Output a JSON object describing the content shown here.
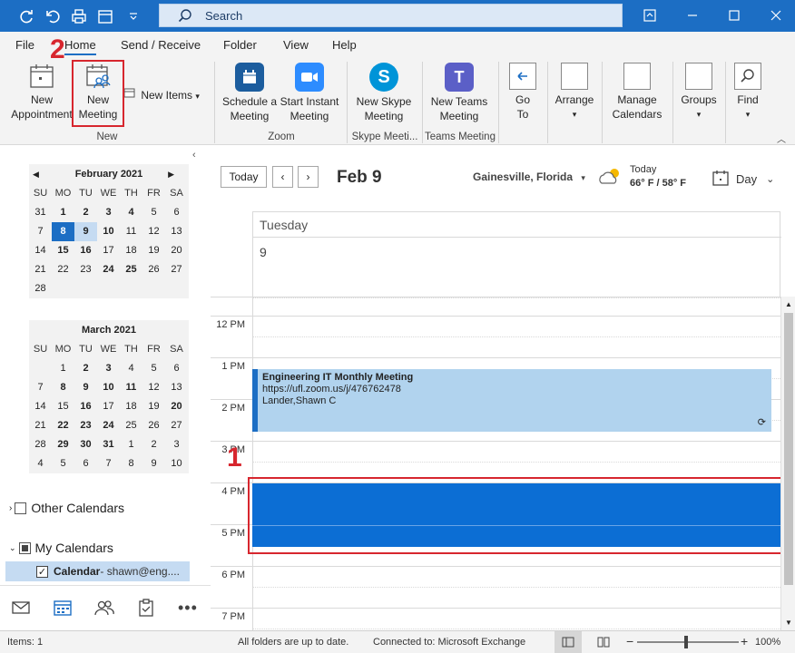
{
  "titlebar": {
    "search_placeholder": "Search"
  },
  "menu": [
    "File",
    "Home",
    "Send / Receive",
    "Folder",
    "View",
    "Help"
  ],
  "ribbon": {
    "new_appointment": [
      "New",
      "Appointment"
    ],
    "new_meeting": [
      "New",
      "Meeting"
    ],
    "new_items": "New Items",
    "group_new": "New",
    "schedule_meeting": [
      "Schedule a",
      "Meeting"
    ],
    "start_instant": [
      "Start Instant",
      "Meeting"
    ],
    "group_zoom": "Zoom",
    "new_skype": [
      "New Skype",
      "Meeting"
    ],
    "group_skype": "Skype Meeti...",
    "new_teams": [
      "New Teams",
      "Meeting"
    ],
    "group_teams": "Teams Meeting",
    "goto": [
      "Go",
      "To"
    ],
    "arrange": "Arrange",
    "manage": [
      "Manage",
      "Calendars"
    ],
    "groups": "Groups",
    "find": "Find"
  },
  "annotations": {
    "step1": "1",
    "step2": "2"
  },
  "minical": [
    {
      "title": "February 2021",
      "dow": [
        "SU",
        "MO",
        "TU",
        "WE",
        "TH",
        "FR",
        "SA"
      ],
      "weeks": [
        [
          "31",
          "1",
          "2",
          "3",
          "4",
          "5",
          "6"
        ],
        [
          "7",
          "8",
          "9",
          "10",
          "11",
          "12",
          "13"
        ],
        [
          "14",
          "15",
          "16",
          "17",
          "18",
          "19",
          "20"
        ],
        [
          "21",
          "22",
          "23",
          "24",
          "25",
          "26",
          "27"
        ],
        [
          "28",
          "",
          "",
          "",
          "",
          "",
          ""
        ]
      ]
    },
    {
      "title": "March 2021",
      "dow": [
        "SU",
        "MO",
        "TU",
        "WE",
        "TH",
        "FR",
        "SA"
      ],
      "weeks": [
        [
          "",
          "1",
          "2",
          "3",
          "4",
          "5",
          "6"
        ],
        [
          "7",
          "8",
          "9",
          "10",
          "11",
          "12",
          "13"
        ],
        [
          "14",
          "15",
          "16",
          "17",
          "18",
          "19",
          "20"
        ],
        [
          "21",
          "22",
          "23",
          "24",
          "25",
          "26",
          "27"
        ],
        [
          "28",
          "29",
          "30",
          "31",
          "1",
          "2",
          "3"
        ],
        [
          "4",
          "5",
          "6",
          "7",
          "8",
          "9",
          "10"
        ]
      ]
    }
  ],
  "folders": {
    "other": "Other Calendars",
    "my": "My Calendars",
    "calendar_name": "Calendar",
    "calendar_owner": " - shawn@eng...."
  },
  "calendar": {
    "today_btn": "Today",
    "date_title": "Feb 9",
    "location": "Gainesville, Florida",
    "weather_label": "Today",
    "weather_temp": "66° F / 58° F",
    "view": "Day",
    "day_name": "Tuesday",
    "day_num": "9",
    "hours": [
      "12 PM",
      "1 PM",
      "2 PM",
      "3 PM",
      "4 PM",
      "5 PM",
      "6 PM",
      "7 PM"
    ],
    "appointment": {
      "title": "Engineering IT Monthly Meeting",
      "url": "https://ufl.zoom.us/j/476762478",
      "organizer": "Lander,Shawn C"
    }
  },
  "status": {
    "items": "Items: 1",
    "sync": "All folders are up to date.",
    "connection": "Connected to: Microsoft Exchange",
    "zoom": "100%"
  },
  "colors": {
    "accent": "#1c6ec4",
    "annotation": "#d7262e",
    "appointment": "#b1d3ee"
  }
}
